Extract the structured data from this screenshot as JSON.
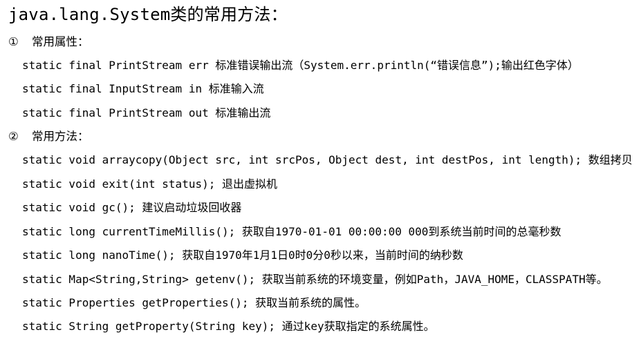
{
  "title": "java.lang.System类的常用方法：",
  "properties_section": {
    "number": "①",
    "heading": "常用属性：",
    "items": [
      "static final PrintStream err 标准错误输出流（System.err.println(“错误信息”);输出红色字体）",
      "static final InputStream in 标准输入流",
      "static final PrintStream out 标准输出流"
    ]
  },
  "methods_section": {
    "number": "②",
    "heading": "常用方法：",
    "items": [
      "static void arraycopy(Object src, int srcPos, Object dest, int destPos, int length); 数组拷贝",
      "static void exit(int status); 退出虚拟机",
      "static void gc(); 建议启动垃圾回收器",
      "static long currentTimeMillis(); 获取自1970-01-01 00:00:00 000到系统当前时间的总毫秒数",
      "static long nanoTime(); 获取自1970年1月1日0时0分0秒以来，当前时间的纳秒数",
      "static Map<String,String> getenv(); 获取当前系统的环境变量，例如Path，JAVA_HOME，CLASSPATH等。",
      "static Properties getProperties(); 获取当前系统的属性。",
      "static String getProperty(String key); 通过key获取指定的系统属性。"
    ]
  }
}
